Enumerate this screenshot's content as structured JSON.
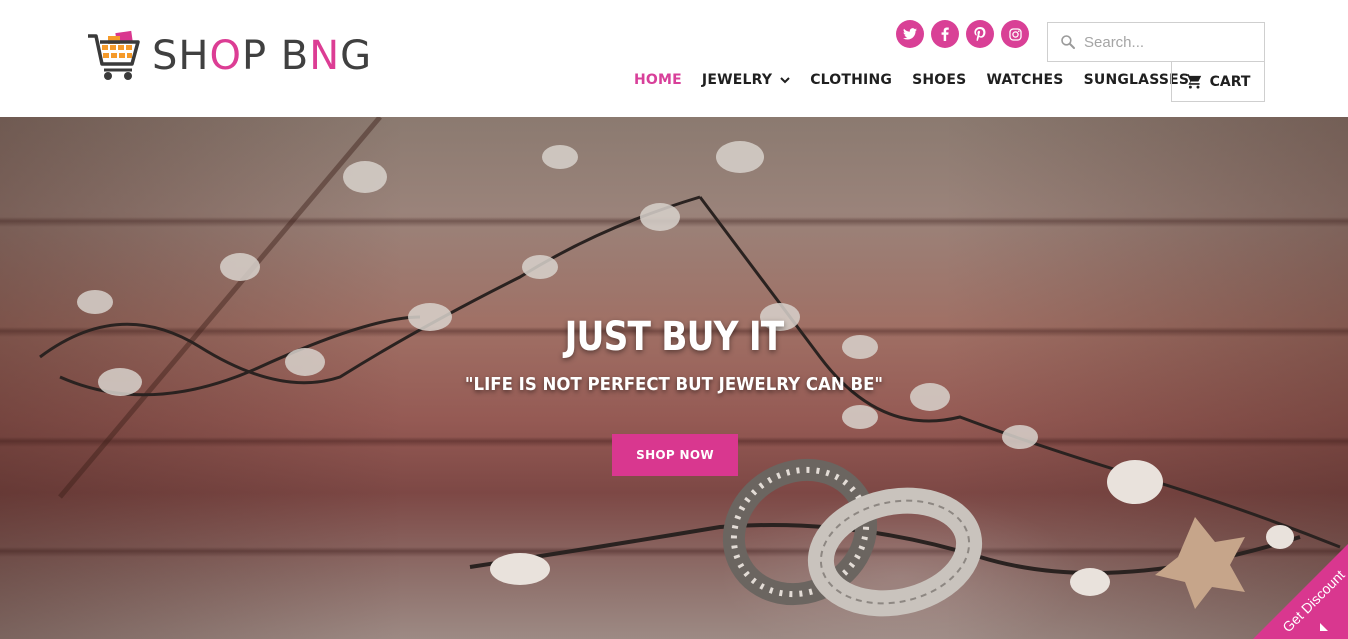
{
  "brand": {
    "logo_prefix": "SH",
    "logo_o": "O",
    "logo_p": "P B",
    "logo_n": "N",
    "logo_g": "G"
  },
  "social": [
    {
      "name": "twitter-icon"
    },
    {
      "name": "facebook-icon"
    },
    {
      "name": "pinterest-icon"
    },
    {
      "name": "instagram-icon"
    }
  ],
  "search": {
    "placeholder": "Search..."
  },
  "nav": {
    "items": [
      {
        "label": "HOME",
        "active": true
      },
      {
        "label": "JEWELRY",
        "dropdown": true
      },
      {
        "label": "CLOTHING"
      },
      {
        "label": "SHOES"
      },
      {
        "label": "WATCHES"
      },
      {
        "label": "SUNGLASSES"
      }
    ]
  },
  "cart": {
    "label": "CART"
  },
  "hero": {
    "title": "JUST BUY IT",
    "subtitle": "\"LIFE IS NOT PERFECT BUT JEWELRY CAN BE\"",
    "cta": "SHOP NOW"
  },
  "discount": {
    "label": "Get Discount"
  },
  "colors": {
    "accent": "#d9378f",
    "text": "#1f1f1f",
    "logo_gray": "#404040"
  }
}
